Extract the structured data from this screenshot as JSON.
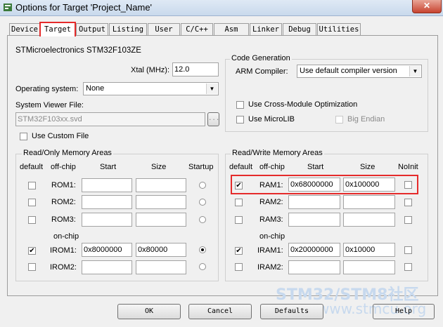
{
  "window": {
    "title": "Options for Target 'Project_Name'",
    "close_glyph": "✕"
  },
  "tabs": [
    {
      "label": "Device"
    },
    {
      "label": "Target"
    },
    {
      "label": "Output"
    },
    {
      "label": "Listing"
    },
    {
      "label": "User"
    },
    {
      "label": "C/C++"
    },
    {
      "label": "Asm"
    },
    {
      "label": "Linker"
    },
    {
      "label": "Debug"
    },
    {
      "label": "Utilities"
    }
  ],
  "device": {
    "name": "STMicroelectronics STM32F103ZE"
  },
  "xtal": {
    "label": "Xtal (MHz):",
    "value": "12.0"
  },
  "os": {
    "label": "Operating system:",
    "value": "None"
  },
  "svf": {
    "label": "System Viewer File:",
    "value": "STM32F103xx.svd",
    "browse": "..."
  },
  "custom_file": {
    "label": "Use Custom File",
    "checked": false
  },
  "codegen": {
    "title": "Code Generation",
    "compiler_label": "ARM Compiler:",
    "compiler_value": "Use default compiler version",
    "cross_module": "Use Cross-Module Optimization",
    "microlib": "Use MicroLIB",
    "big_endian": "Big Endian"
  },
  "rom": {
    "title": "Read/Only Memory Areas",
    "headers": {
      "default": "default",
      "offchip": "off-chip",
      "start": "Start",
      "size": "Size",
      "startup": "Startup"
    },
    "onchip_label": "on-chip",
    "rows": [
      {
        "name": "ROM1:",
        "default": false,
        "start": "",
        "size": "",
        "startup": false
      },
      {
        "name": "ROM2:",
        "default": false,
        "start": "",
        "size": "",
        "startup": false
      },
      {
        "name": "ROM3:",
        "default": false,
        "start": "",
        "size": "",
        "startup": false
      },
      {
        "name": "IROM1:",
        "default": true,
        "start": "0x8000000",
        "size": "0x80000",
        "startup": true
      },
      {
        "name": "IROM2:",
        "default": false,
        "start": "",
        "size": "",
        "startup": false
      }
    ]
  },
  "ram": {
    "title": "Read/Write Memory Areas",
    "headers": {
      "default": "default",
      "offchip": "off-chip",
      "start": "Start",
      "size": "Size",
      "noinit": "NoInit"
    },
    "onchip_label": "on-chip",
    "rows": [
      {
        "name": "RAM1:",
        "default": true,
        "start": "0x68000000",
        "size": "0x100000",
        "noinit": false
      },
      {
        "name": "RAM2:",
        "default": false,
        "start": "",
        "size": "",
        "noinit": false
      },
      {
        "name": "RAM3:",
        "default": false,
        "start": "",
        "size": "",
        "noinit": false
      },
      {
        "name": "IRAM1:",
        "default": true,
        "start": "0x20000000",
        "size": "0x10000",
        "noinit": false
      },
      {
        "name": "IRAM2:",
        "default": false,
        "start": "",
        "size": "",
        "noinit": false
      }
    ]
  },
  "buttons": {
    "ok": "OK",
    "cancel": "Cancel",
    "defaults": "Defaults",
    "help": "Help"
  },
  "watermark": {
    "line1": "STM32/STM8社区",
    "line2": "www.stmcu.org"
  },
  "colors": {
    "highlight": "#e52b2b"
  }
}
